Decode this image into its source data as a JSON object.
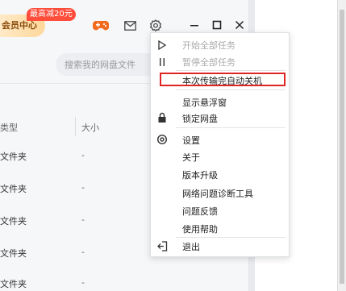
{
  "header": {
    "vip_label": "会员中心",
    "promo_tag": "最高减20元"
  },
  "search": {
    "placeholder": "搜索我的网盘文件"
  },
  "table": {
    "columns": [
      "类型",
      "大小"
    ],
    "rows": [
      {
        "type": "文件夹",
        "size": "-"
      },
      {
        "type": "文件夹",
        "size": "-"
      },
      {
        "type": "文件夹",
        "size": "-"
      },
      {
        "type": "文件夹",
        "size": "-"
      },
      {
        "type": "文件夹",
        "size": "-"
      }
    ]
  },
  "menu": {
    "items": [
      {
        "label": "开始全部任务",
        "enabled": false
      },
      {
        "label": "暂停全部任务",
        "enabled": false
      },
      {
        "label": "本次传输完自动关机",
        "enabled": true,
        "highlighted": true
      },
      {
        "label": "显示悬浮窗",
        "enabled": true
      },
      {
        "label": "锁定网盘",
        "enabled": true
      },
      {
        "label": "设置",
        "enabled": true
      },
      {
        "label": "关于",
        "enabled": true
      },
      {
        "label": "版本升级",
        "enabled": true
      },
      {
        "label": "网络问题诊断工具",
        "enabled": true
      },
      {
        "label": "问题反馈",
        "enabled": true
      },
      {
        "label": "使用帮助",
        "enabled": true
      },
      {
        "label": "退出",
        "enabled": true
      }
    ],
    "icons": [
      "play-icon",
      "pause-icon",
      "lock-icon",
      "settings-circle-icon",
      "exit-icon"
    ]
  },
  "colors": {
    "highlight": "#e02424",
    "promo": "#ff4d3b",
    "vip_text": "#8a4b0a"
  }
}
